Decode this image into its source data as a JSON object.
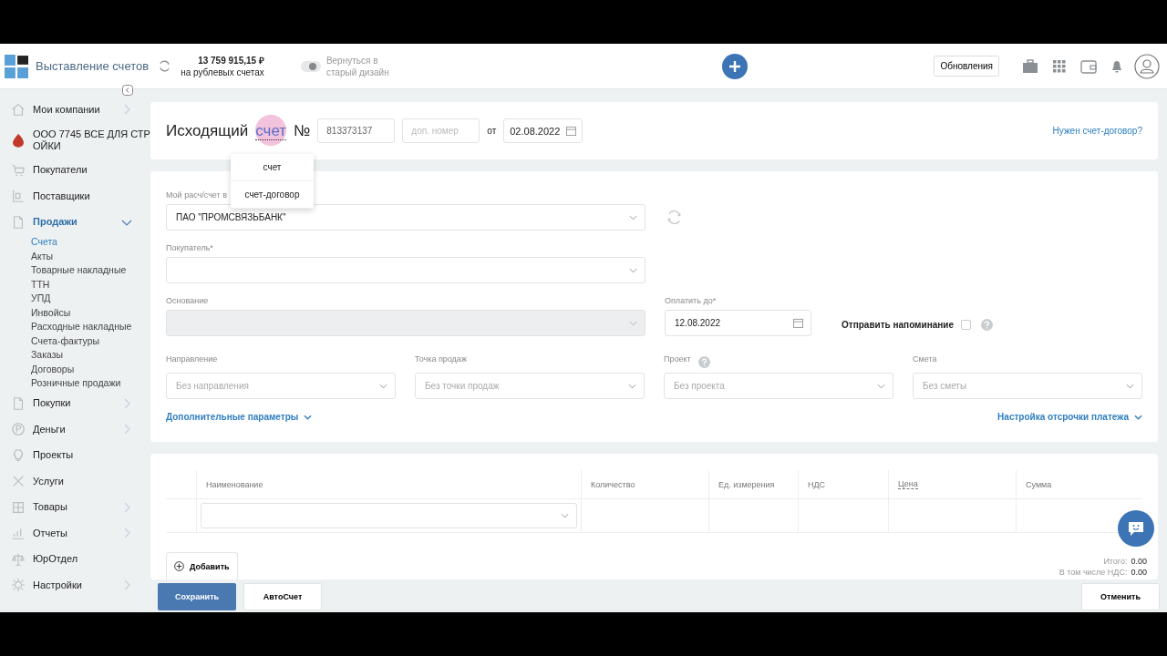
{
  "header": {
    "app_title": "Выставление счетов",
    "balance": "13 759 915,15 ₽",
    "balance_caption": "на рублевых счетах",
    "old_design_toggle": {
      "label": "Вернуться в старый дизайн",
      "on": false
    },
    "updates_button": "Обновления"
  },
  "sidebar": {
    "items": [
      {
        "label": "Мои компании",
        "kind": "group",
        "expanded": false,
        "selected": false
      },
      {
        "label": "ООО 7745 ВСЕ ДЛЯ СТР ОЙКИ",
        "kind": "company",
        "selected": false
      },
      {
        "label": "Покупатели",
        "kind": "link",
        "selected": false
      },
      {
        "label": "Поставщики",
        "kind": "link",
        "selected": false
      },
      {
        "label": "Продажи",
        "kind": "group",
        "expanded": true,
        "selected": true,
        "children": [
          {
            "label": "Счета",
            "selected": true
          },
          {
            "label": "Акты",
            "selected": false
          },
          {
            "label": "Товарные накладные",
            "selected": false
          },
          {
            "label": "ТТН",
            "selected": false
          },
          {
            "label": "УПД",
            "selected": false
          },
          {
            "label": "Инвойсы",
            "selected": false
          },
          {
            "label": "Расходные накладные",
            "selected": false
          },
          {
            "label": "Счета-фактуры",
            "selected": false
          },
          {
            "label": "Заказы",
            "selected": false
          },
          {
            "label": "Договоры",
            "selected": false
          },
          {
            "label": "Розничные продажи",
            "selected": false
          }
        ]
      },
      {
        "label": "Покупки",
        "kind": "group",
        "expanded": false,
        "selected": false
      },
      {
        "label": "Деньги",
        "kind": "group",
        "expanded": false,
        "selected": false
      },
      {
        "label": "Проекты",
        "kind": "link",
        "selected": false
      },
      {
        "label": "Услуги",
        "kind": "link",
        "selected": false
      },
      {
        "label": "Товары",
        "kind": "group",
        "expanded": false,
        "selected": false
      },
      {
        "label": "Отчеты",
        "kind": "group",
        "expanded": false,
        "selected": false
      },
      {
        "label": "ЮрОтдел",
        "kind": "link",
        "selected": false
      },
      {
        "label": "Настройки",
        "kind": "group",
        "expanded": false,
        "selected": false
      }
    ]
  },
  "doc_header": {
    "title": "Исходящий",
    "type_link": "счет",
    "number_sign": "№",
    "number": "813373137",
    "extra_number_placeholder": "доп. номер",
    "from": "от",
    "date": "02.08.2022",
    "contract_link": "Нужен счет-договор?"
  },
  "type_dropdown": {
    "options": [
      "счет",
      "счет-договор"
    ]
  },
  "form": {
    "account": {
      "label": "Мой расч/счет в",
      "value": "ПАО \"ПРОМСВЯЗЬБАНК\""
    },
    "buyer": {
      "label": "Покупатель*"
    },
    "basis": {
      "label": "Основание",
      "disabled": true
    },
    "pay_by": {
      "label": "Оплатить до*",
      "value": "12.08.2022"
    },
    "reminder": {
      "label": "Отправить напоминание",
      "checked": false
    },
    "selects": [
      {
        "label": "Направление",
        "placeholder": "Без направления",
        "help": false
      },
      {
        "label": "Точка продаж",
        "placeholder": "Без точки продаж",
        "help": false
      },
      {
        "label": "Проект",
        "placeholder": "Без проекта",
        "help": true
      },
      {
        "label": "Смета",
        "placeholder": "Без сметы",
        "help": false
      }
    ],
    "more_params_link": "Дополнительные параметры",
    "deferral_link": "Настройка отсрочки платежа"
  },
  "items_table": {
    "columns": [
      "Наименование",
      "Количество",
      "Ед. измерения",
      "НДС",
      "Цена",
      "Сумма"
    ],
    "add_button": "Добавить",
    "totals": [
      {
        "label": "Итого:",
        "value": "0.00"
      },
      {
        "label": "В том числе НДС:",
        "value": "0.00"
      }
    ]
  },
  "footer": {
    "save_button": "Сохранить",
    "autoinvoice_button": "АвтоСчет",
    "cancel_button": "Отменить"
  }
}
